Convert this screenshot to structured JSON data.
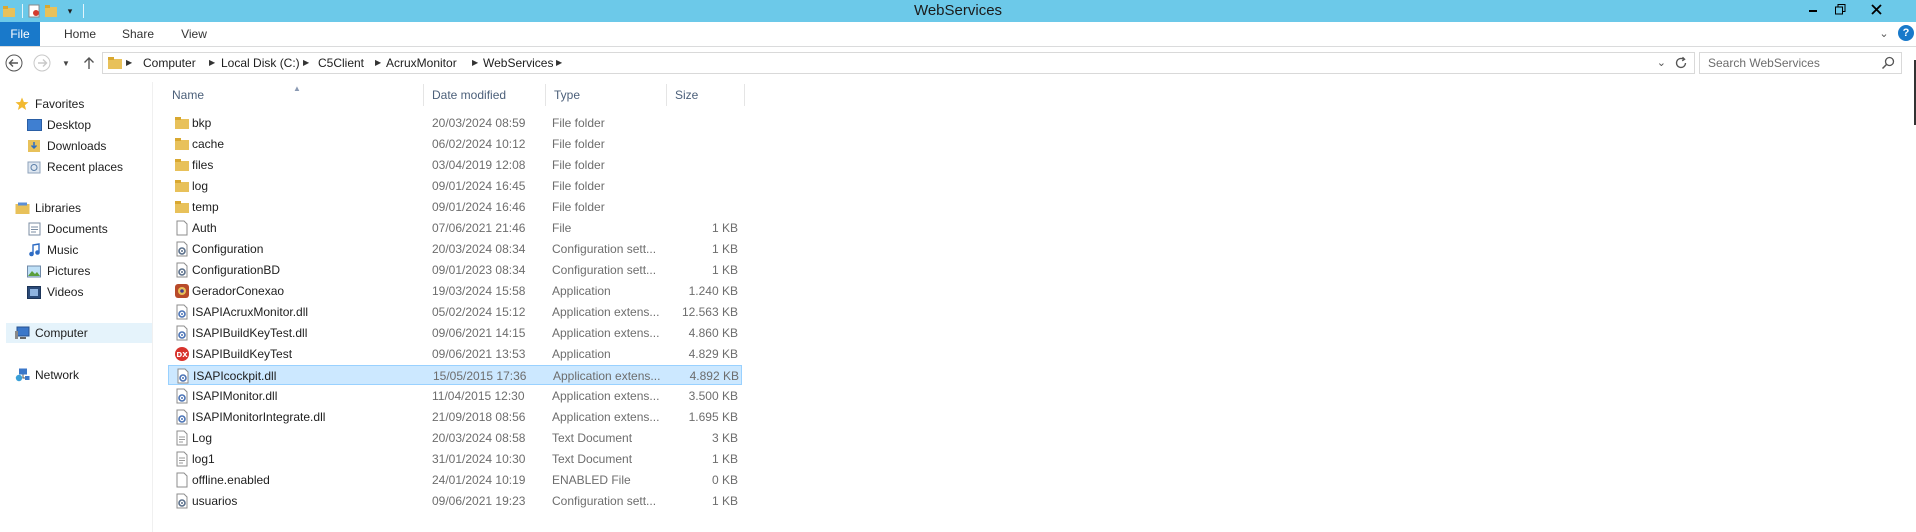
{
  "window": {
    "title": "WebServices"
  },
  "ribbon": {
    "tabs": [
      {
        "label": "File",
        "active": true
      },
      {
        "label": "Home"
      },
      {
        "label": "Share"
      },
      {
        "label": "View"
      }
    ]
  },
  "address": {
    "crumbs": [
      "Computer",
      "Local Disk (C:)",
      "C5Client",
      "AcruxMonitor",
      "WebServices"
    ]
  },
  "search": {
    "placeholder": "Search WebServices"
  },
  "nav": {
    "favorites": {
      "label": "Favorites",
      "items": [
        {
          "label": "Desktop"
        },
        {
          "label": "Downloads"
        },
        {
          "label": "Recent places"
        }
      ]
    },
    "libraries": {
      "label": "Libraries",
      "items": [
        {
          "label": "Documents"
        },
        {
          "label": "Music"
        },
        {
          "label": "Pictures"
        },
        {
          "label": "Videos"
        }
      ]
    },
    "computer": {
      "label": "Computer"
    },
    "network": {
      "label": "Network"
    }
  },
  "columns": {
    "name": "Name",
    "date": "Date modified",
    "type": "Type",
    "size": "Size"
  },
  "files": [
    {
      "name": "bkp",
      "date": "20/03/2024 08:59",
      "type": "File folder",
      "size": "",
      "icon": "folder"
    },
    {
      "name": "cache",
      "date": "06/02/2024 10:12",
      "type": "File folder",
      "size": "",
      "icon": "folder"
    },
    {
      "name": "files",
      "date": "03/04/2019 12:08",
      "type": "File folder",
      "size": "",
      "icon": "folder"
    },
    {
      "name": "log",
      "date": "09/01/2024 16:45",
      "type": "File folder",
      "size": "",
      "icon": "folder"
    },
    {
      "name": "temp",
      "date": "09/01/2024 16:46",
      "type": "File folder",
      "size": "",
      "icon": "folder"
    },
    {
      "name": "Auth",
      "date": "07/06/2021 21:46",
      "type": "File",
      "size": "1 KB",
      "icon": "file"
    },
    {
      "name": "Configuration",
      "date": "20/03/2024 08:34",
      "type": "Configuration sett...",
      "size": "1 KB",
      "icon": "config"
    },
    {
      "name": "ConfigurationBD",
      "date": "09/01/2023 08:34",
      "type": "Configuration sett...",
      "size": "1 KB",
      "icon": "config"
    },
    {
      "name": "GeradorConexao",
      "date": "19/03/2024 15:58",
      "type": "Application",
      "size": "1.240 KB",
      "icon": "app"
    },
    {
      "name": "ISAPIAcruxMonitor.dll",
      "date": "05/02/2024 15:12",
      "type": "Application extens...",
      "size": "12.563 KB",
      "icon": "dll"
    },
    {
      "name": "ISAPIBuildKeyTest.dll",
      "date": "09/06/2021 14:15",
      "type": "Application extens...",
      "size": "4.860 KB",
      "icon": "dll"
    },
    {
      "name": "ISAPIBuildKeyTest",
      "date": "09/06/2021 13:53",
      "type": "Application",
      "size": "4.829 KB",
      "icon": "exe-red"
    },
    {
      "name": "ISAPIcockpit.dll",
      "date": "15/05/2015 17:36",
      "type": "Application extens...",
      "size": "4.892 KB",
      "icon": "dll",
      "selected": true
    },
    {
      "name": "ISAPIMonitor.dll",
      "date": "11/04/2015 12:30",
      "type": "Application extens...",
      "size": "3.500 KB",
      "icon": "dll"
    },
    {
      "name": "ISAPIMonitorIntegrate.dll",
      "date": "21/09/2018 08:56",
      "type": "Application extens...",
      "size": "1.695 KB",
      "icon": "dll"
    },
    {
      "name": "Log",
      "date": "20/03/2024 08:58",
      "type": "Text Document",
      "size": "3 KB",
      "icon": "text"
    },
    {
      "name": "log1",
      "date": "31/01/2024 10:30",
      "type": "Text Document",
      "size": "1 KB",
      "icon": "text"
    },
    {
      "name": "offline.enabled",
      "date": "24/01/2024 10:19",
      "type": "ENABLED File",
      "size": "0 KB",
      "icon": "file"
    },
    {
      "name": "usuarios",
      "date": "09/06/2021 19:23",
      "type": "Configuration sett...",
      "size": "1 KB",
      "icon": "config"
    }
  ],
  "colors": {
    "titlebar": "#6cc9e9",
    "file_tab": "#1979ca",
    "selection": "#cce8ff",
    "selection_border": "#99d1ff"
  }
}
